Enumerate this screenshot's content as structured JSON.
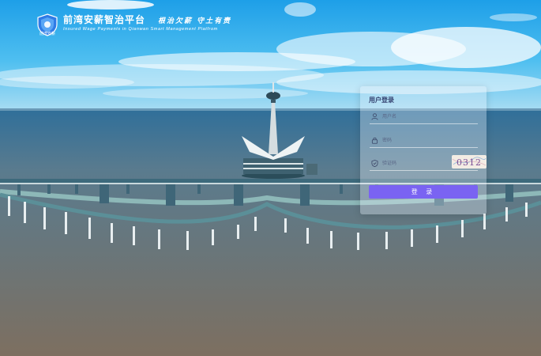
{
  "header": {
    "logo_text": "前湾安薪",
    "title": "前湾安薪智治平台",
    "subtitle": "Insured Wage Payments in Qianwan Smart Management Platfrom",
    "slogan": "根治欠薪 守土有责"
  },
  "login": {
    "title": "用户登录",
    "username_placeholder": "用户名",
    "password_placeholder": "密码",
    "captcha_placeholder": "验证码",
    "captcha_text": "0312",
    "submit_label": "登 录"
  },
  "colors": {
    "accent": "#7a63f2",
    "card_title": "#33406e"
  },
  "icons": [
    "shield-logo-icon",
    "user-icon",
    "lock-icon",
    "shield-check-icon"
  ]
}
